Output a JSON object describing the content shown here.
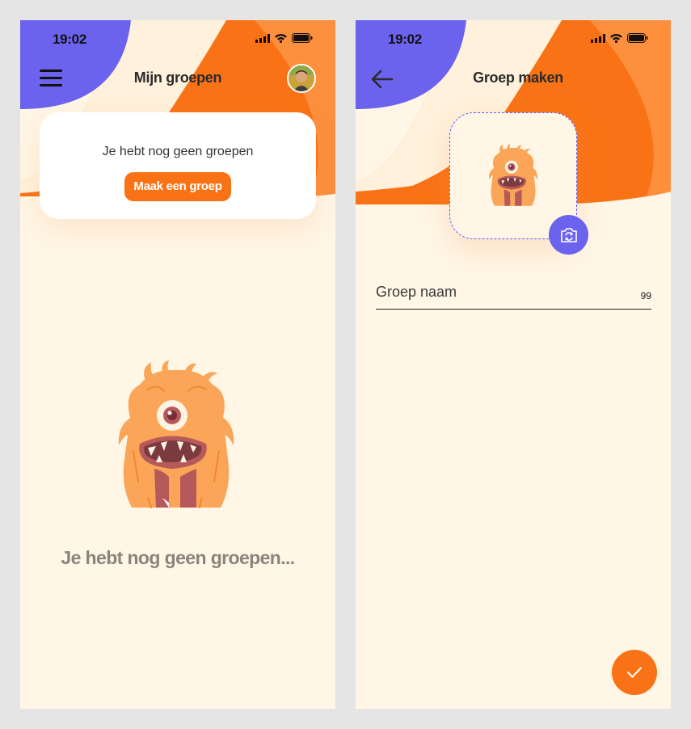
{
  "colors": {
    "background": "#fff6e6",
    "accent_orange": "#f97316",
    "accent_orange_light": "#fd8f3d",
    "accent_purple": "#6b63ee",
    "text_muted": "#8a857c"
  },
  "left_screen": {
    "status_bar": {
      "time": "19:02",
      "icons": [
        "signal-icon",
        "wifi-icon",
        "battery-icon"
      ]
    },
    "header": {
      "title": "Mijn groepen",
      "menu_icon": "menu-icon",
      "avatar": "user-avatar"
    },
    "card": {
      "message": "Je hebt nog geen groepen",
      "button_label": "Maak een groep"
    },
    "illustration": "monster-illustration",
    "empty_state_title": "Je hebt nog geen groepen..."
  },
  "right_screen": {
    "status_bar": {
      "time": "19:02",
      "icons": [
        "signal-icon",
        "wifi-icon",
        "battery-icon"
      ]
    },
    "header": {
      "title": "Groep maken",
      "back_icon": "arrow-left-icon"
    },
    "group_image": {
      "illustration": "monster-illustration",
      "camera_icon": "camera-switch-icon"
    },
    "name_field": {
      "placeholder": "Groep naam",
      "value": "",
      "char_counter": "99"
    },
    "confirm_icon": "checkmark-icon"
  }
}
